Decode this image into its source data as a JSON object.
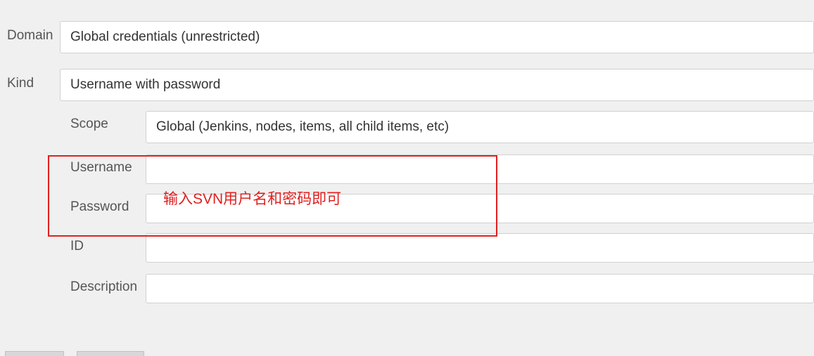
{
  "form": {
    "domain": {
      "label": "Domain",
      "value": "Global credentials (unrestricted)"
    },
    "kind": {
      "label": "Kind",
      "value": "Username with password"
    },
    "scope": {
      "label": "Scope",
      "value": "Global (Jenkins, nodes, items, all child items, etc)"
    },
    "username": {
      "label": "Username",
      "value": ""
    },
    "password": {
      "label": "Password",
      "value": ""
    },
    "id": {
      "label": "ID",
      "value": ""
    },
    "description": {
      "label": "Description",
      "value": ""
    }
  },
  "annotation": {
    "text": "输入SVN用户名和密码即可"
  }
}
